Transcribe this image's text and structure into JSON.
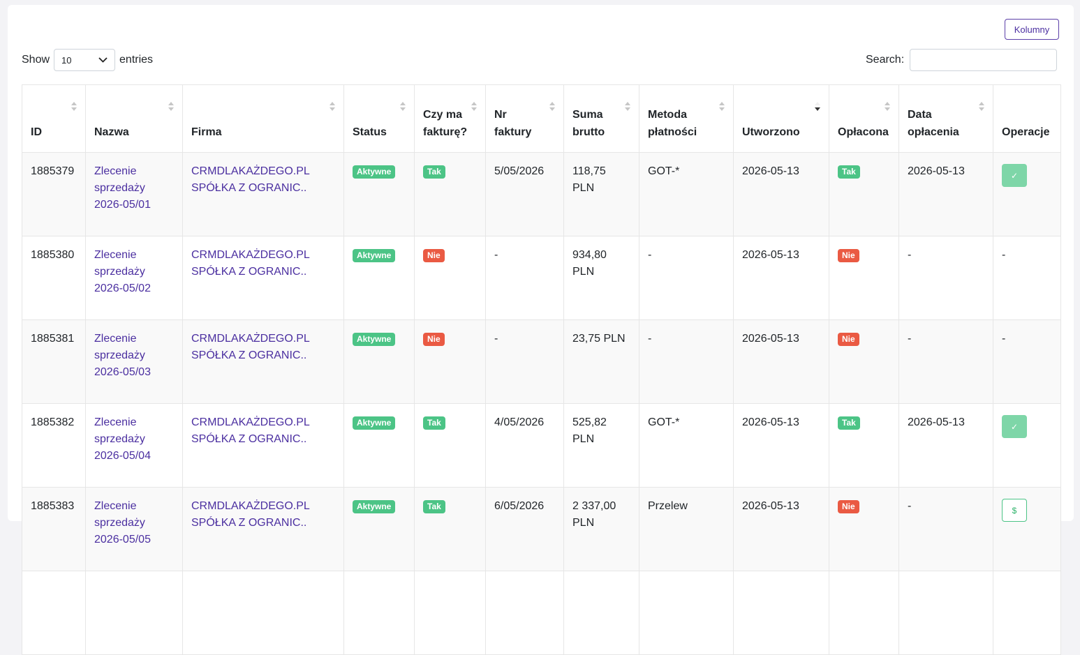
{
  "toolbar": {
    "columns_label": "Kolumny"
  },
  "length": {
    "show_label": "Show",
    "value": "10",
    "entries_label": "entries",
    "chevron": "chevron-down-icon"
  },
  "search": {
    "label": "Search:",
    "value": "",
    "placeholder": ""
  },
  "colors": {
    "accent": "#4b2fa0",
    "green": "#4cc486",
    "red": "#ea5a43"
  },
  "columns": [
    {
      "l1": "",
      "l2": "ID",
      "sort": "none"
    },
    {
      "l1": "",
      "l2": "Nazwa",
      "sort": "none"
    },
    {
      "l1": "",
      "l2": "Firma",
      "sort": "none"
    },
    {
      "l1": "",
      "l2": "Status",
      "sort": "none"
    },
    {
      "l1": "Czy ma",
      "l2": "fakturę?",
      "sort": "none"
    },
    {
      "l1": "Nr",
      "l2": "faktury",
      "sort": "none"
    },
    {
      "l1": "Suma",
      "l2": "brutto",
      "sort": "none"
    },
    {
      "l1": "Metoda",
      "l2": "płatności",
      "sort": "none"
    },
    {
      "l1": "",
      "l2": "Utworzono",
      "sort": "desc"
    },
    {
      "l1": "",
      "l2": "Opłacona",
      "sort": "none"
    },
    {
      "l1": "Data",
      "l2": "opłacenia",
      "sort": "none"
    },
    {
      "l1": "",
      "l2": "Operacje",
      "sort": "none"
    }
  ],
  "rows": [
    {
      "id": "1885379",
      "name": [
        "Zlecenie",
        "sprzedaży",
        "2026-05/01"
      ],
      "company": [
        "CRMDLAKAŻDEGO.PL",
        "SPÓŁKA Z OGRANIC.."
      ],
      "status": "Aktywne",
      "invoice": "Tak",
      "invoice_no": "5/05/2026",
      "sum": [
        "118,75 PLN"
      ],
      "method": "GOT-*",
      "created": "2026-05-13",
      "paid": "Tak",
      "paid_date": "2026-05-13",
      "op": {
        "type": "done",
        "glyph": "✓",
        "icon": "check-icon"
      }
    },
    {
      "id": "1885380",
      "name": [
        "Zlecenie",
        "sprzedaży",
        "2026-05/02"
      ],
      "company": [
        "CRMDLAKAŻDEGO.PL",
        "SPÓŁKA Z OGRANIC.."
      ],
      "status": "Aktywne",
      "invoice": "Nie",
      "invoice_no": "-",
      "sum": [
        "934,80",
        "PLN"
      ],
      "method": "-",
      "created": "2026-05-13",
      "paid": "Nie",
      "paid_date": "-",
      "op": {
        "type": "none",
        "text": "-"
      }
    },
    {
      "id": "1885381",
      "name": [
        "Zlecenie",
        "sprzedaży",
        "2026-05/03"
      ],
      "company": [
        "CRMDLAKAŻDEGO.PL",
        "SPÓŁKA Z OGRANIC.."
      ],
      "status": "Aktywne",
      "invoice": "Nie",
      "invoice_no": "-",
      "sum": [
        "23,75 PLN"
      ],
      "method": "-",
      "created": "2026-05-13",
      "paid": "Nie",
      "paid_date": "-",
      "op": {
        "type": "none",
        "text": "-"
      }
    },
    {
      "id": "1885382",
      "name": [
        "Zlecenie",
        "sprzedaży",
        "2026-05/04"
      ],
      "company": [
        "CRMDLAKAŻDEGO.PL",
        "SPÓŁKA Z OGRANIC.."
      ],
      "status": "Aktywne",
      "invoice": "Tak",
      "invoice_no": "4/05/2026",
      "sum": [
        "525,82",
        "PLN"
      ],
      "method": "GOT-*",
      "created": "2026-05-13",
      "paid": "Tak",
      "paid_date": "2026-05-13",
      "op": {
        "type": "done",
        "glyph": "✓",
        "icon": "check-icon"
      }
    },
    {
      "id": "1885383",
      "name": [
        "Zlecenie",
        "sprzedaży",
        "2026-05/05"
      ],
      "company": [
        "CRMDLAKAŻDEGO.PL",
        "SPÓŁKA Z OGRANIC.."
      ],
      "status": "Aktywne",
      "invoice": "Tak",
      "invoice_no": "6/05/2026",
      "sum": [
        "2 337,00",
        "PLN"
      ],
      "method": "Przelew",
      "created": "2026-05-13",
      "paid": "Nie",
      "paid_date": "-",
      "op": {
        "type": "pay",
        "glyph": "$",
        "icon": "dollar-icon"
      }
    },
    {
      "id": "",
      "name": [],
      "company": [],
      "status": "",
      "invoice": "",
      "invoice_no": "",
      "sum": [],
      "method": "",
      "created": "",
      "paid": "",
      "paid_date": "",
      "op": {
        "type": "none",
        "text": ""
      }
    }
  ]
}
